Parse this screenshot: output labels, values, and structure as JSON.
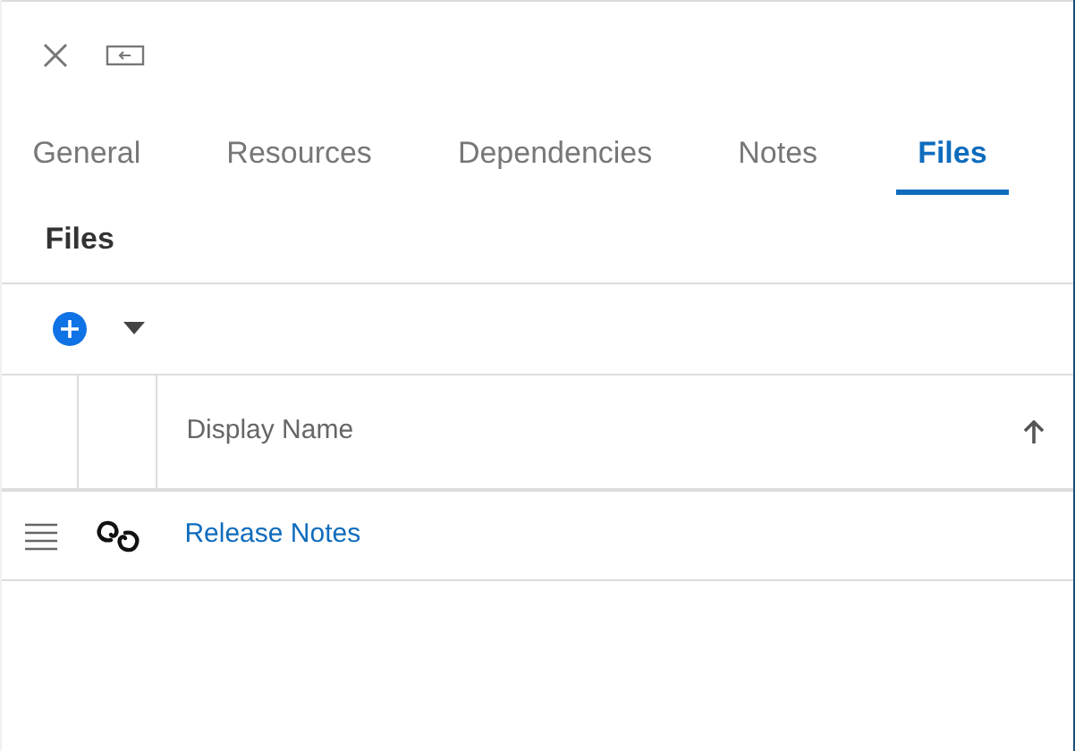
{
  "tabs": [
    {
      "label": "General",
      "selected": false
    },
    {
      "label": "Resources",
      "selected": false
    },
    {
      "label": "Dependencies",
      "selected": false
    },
    {
      "label": "Notes",
      "selected": false
    },
    {
      "label": "Files",
      "selected": true
    }
  ],
  "section_title": "Files",
  "table": {
    "columns": [
      {
        "label": "Display Name",
        "sort_ascending": true
      }
    ],
    "rows": [
      {
        "name": "Release Notes"
      }
    ]
  }
}
